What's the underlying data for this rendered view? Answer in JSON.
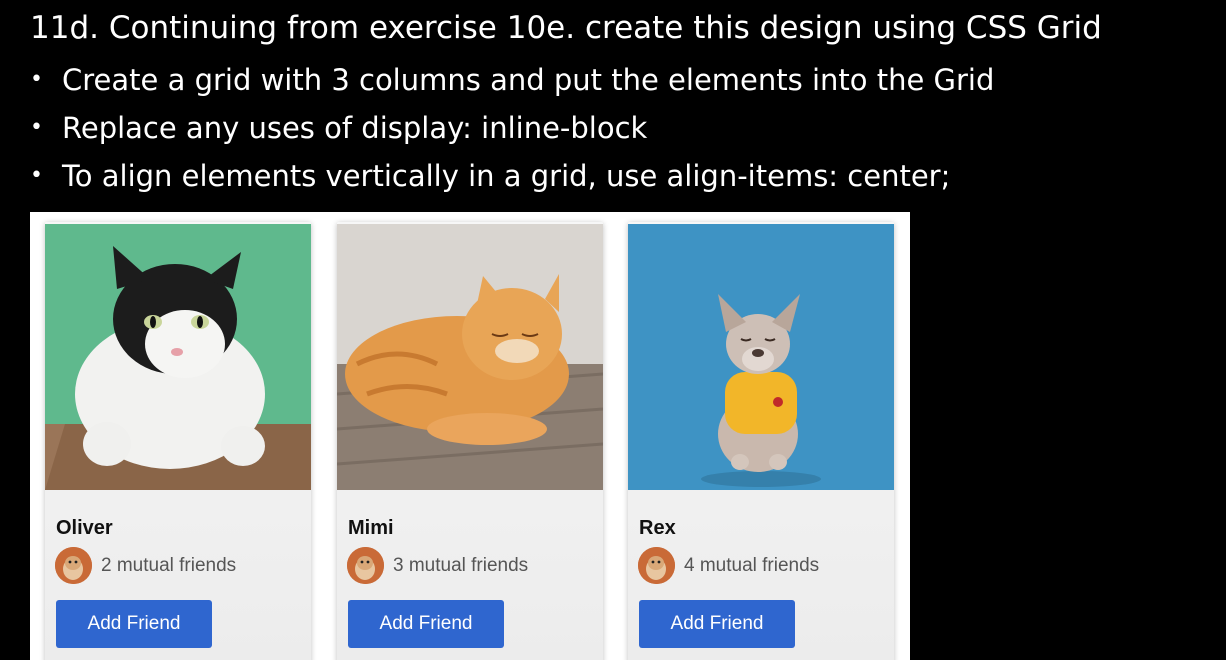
{
  "slide": {
    "title": "11d. Continuing from exercise 10e. create this design using CSS Grid",
    "bullets": [
      "Create a grid with 3 columns and put the elements into the Grid",
      "Replace any uses of display: inline-block",
      "To align elements vertically in a grid, use align-items: center;"
    ]
  },
  "cards": [
    {
      "name": "Oliver",
      "mutual": "2 mutual friends",
      "button": "Add Friend"
    },
    {
      "name": "Mimi",
      "mutual": "3 mutual friends",
      "button": "Add Friend"
    },
    {
      "name": "Rex",
      "mutual": "4 mutual friends",
      "button": "Add Friend"
    }
  ],
  "colors": {
    "button": "#2f66cf",
    "background": "#000000",
    "panel": "#ffffff"
  }
}
